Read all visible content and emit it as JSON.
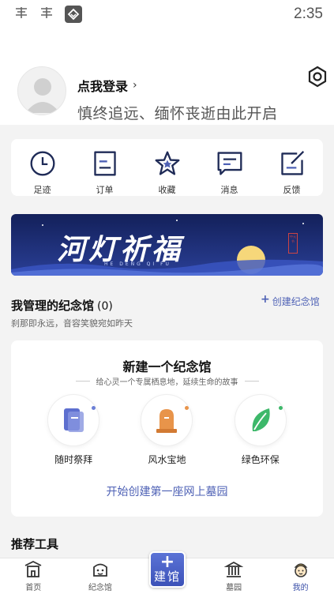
{
  "status_bar": {
    "time": "2:35",
    "notification_glyphs": [
      "𝟏",
      "𝟏"
    ]
  },
  "profile": {
    "login_label": "点我登录",
    "chevron": "›",
    "motto": "慎终追远、缅怀丧逝由此开启",
    "settings_icon": "hexagon-settings-icon"
  },
  "quick_actions": [
    {
      "label": "足迹",
      "icon": "clock-icon"
    },
    {
      "label": "订单",
      "icon": "document-icon"
    },
    {
      "label": "收藏",
      "icon": "star-icon"
    },
    {
      "label": "消息",
      "icon": "message-icon"
    },
    {
      "label": "反馈",
      "icon": "edit-icon"
    }
  ],
  "banner": {
    "title": "河灯祈福",
    "subtitle": "HE DENG QI FU",
    "seal": "中元节"
  },
  "memorial": {
    "title": "我管理的纪念馆",
    "count": "(0)",
    "subtitle": "刹那即永远，音容笑貌宛如昨天",
    "create_label": "创建纪念馆",
    "create_plus": "+"
  },
  "new_memorial": {
    "title": "新建一个纪念馆",
    "subtitle": "给心灵一个专属栖息地，延续生命的故事",
    "features": [
      {
        "label": "随时祭拜",
        "icon": "phone-icon",
        "dot_color": "#6b7fd6"
      },
      {
        "label": "风水宝地",
        "icon": "tombstone-icon",
        "dot_color": "#e8944a"
      },
      {
        "label": "绿色环保",
        "icon": "leaf-icon",
        "dot_color": "#3db86a"
      }
    ],
    "start_link": "开始创建第一座网上墓园"
  },
  "tools": {
    "title": "推荐工具"
  },
  "tabbar": {
    "tabs": [
      {
        "label": "首页",
        "icon": "home-temple-icon"
      },
      {
        "label": "纪念馆",
        "icon": "memorial-icon"
      },
      {
        "label": "建馆",
        "icon": "plus-icon"
      },
      {
        "label": "墓园",
        "icon": "cemetery-icon"
      },
      {
        "label": "我的",
        "icon": "profile-icon"
      }
    ],
    "build_plus": "+",
    "build_label": "建馆",
    "active": "我的"
  },
  "colors": {
    "accent": "#4e61b5",
    "banner_bg": "#1b2a6b"
  }
}
